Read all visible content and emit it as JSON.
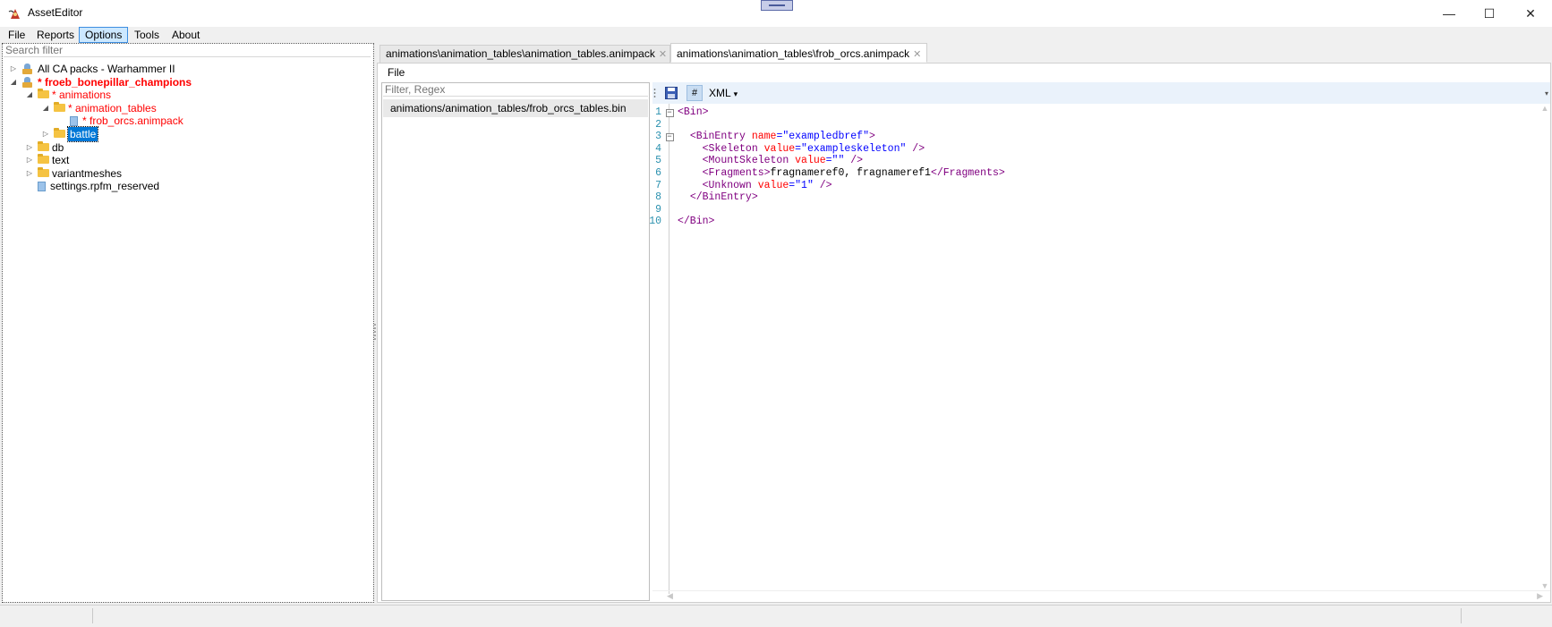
{
  "window": {
    "title": "AssetEditor",
    "controls": {
      "minimize": "—",
      "maximize": "☐",
      "close": "✕"
    }
  },
  "menu": [
    "File",
    "Reports",
    "Options",
    "Tools",
    "About"
  ],
  "left": {
    "search_placeholder": "Search filter",
    "tree": [
      {
        "label": "All CA packs - Warhammer II",
        "kind": "pack",
        "expander": "▷",
        "red": false,
        "bold": false
      },
      {
        "label": "* froeb_bonepillar_champions",
        "kind": "pack",
        "expander": "◢",
        "red": true,
        "bold": true
      },
      {
        "label": "* animations",
        "kind": "folder",
        "expander": "◢",
        "red": true,
        "bold": false
      },
      {
        "label": "* animation_tables",
        "kind": "folder",
        "expander": "◢",
        "red": true,
        "bold": false
      },
      {
        "label": "* frob_orcs.animpack",
        "kind": "file",
        "expander": "",
        "red": true,
        "bold": false
      },
      {
        "label": "battle",
        "kind": "folder",
        "expander": "▷",
        "red": false,
        "bold": false,
        "selected": true
      },
      {
        "label": "db",
        "kind": "folder",
        "expander": "▷",
        "red": false,
        "bold": false
      },
      {
        "label": "text",
        "kind": "folder",
        "expander": "▷",
        "red": false,
        "bold": false
      },
      {
        "label": "variantmeshes",
        "kind": "folder",
        "expander": "▷",
        "red": false,
        "bold": false
      },
      {
        "label": "settings.rpfm_reserved",
        "kind": "file",
        "expander": "",
        "red": false,
        "bold": false
      }
    ]
  },
  "tabs": [
    {
      "label": "animations\\animation_tables\\animation_tables.animpack",
      "active": false
    },
    {
      "label": "animations\\animation_tables\\frob_orcs.animpack",
      "active": true
    }
  ],
  "editor": {
    "menu_file": "File",
    "filter_placeholder": "Filter, Regex",
    "files": [
      "animations/animation_tables/frob_orcs_tables.bin"
    ],
    "toolbar": {
      "save_icon": "floppy-disk-icon",
      "hash_label": "#",
      "format_label": "XML",
      "format_arrow": "▾"
    },
    "code": [
      "<Bin>",
      "",
      "  <BinEntry name=\"exampledbref\">",
      "    <Skeleton value=\"exampleskeleton\" />",
      "    <MountSkeleton value=\"\" />",
      "    <Fragments>fragnameref0, fragnameref1</Fragments>",
      "    <Unknown value=\"1\" />",
      "  </BinEntry>",
      "",
      "</Bin>"
    ]
  },
  "colors": {
    "accent": "#0078d7",
    "modified": "#ff0000",
    "tag": "#a31515",
    "attr": "#ff0000",
    "value": "#0000ff"
  }
}
